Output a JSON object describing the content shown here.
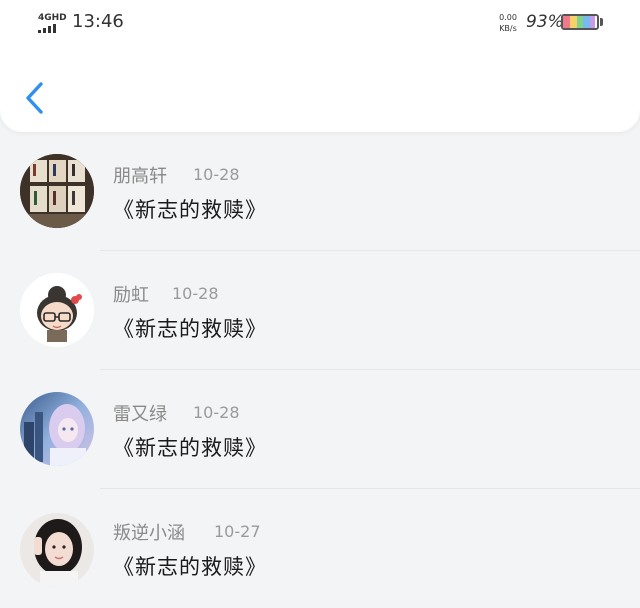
{
  "status_bar": {
    "network": "4GHD",
    "time": "13:46",
    "speed_value": "0.00",
    "speed_unit": "KB/s",
    "battery_percent": "93%"
  },
  "header": {
    "back_icon": "chevron-left-icon",
    "accent_color": "#2f8ff0"
  },
  "comments": [
    {
      "name": "朋高轩",
      "date": "10-28",
      "message": "《新志的救赎》",
      "avatar": "bookshelf-photo"
    },
    {
      "name": "励虹",
      "date": "10-28",
      "message": "《新志的救赎》",
      "avatar": "cartoon-girl-glasses"
    },
    {
      "name": "雷又绿",
      "date": "10-28",
      "message": "《新志的救赎》",
      "avatar": "anime-girl-art"
    },
    {
      "name": "叛逆小涵",
      "date": "10-27",
      "message": "《新志的救赎》",
      "avatar": "girl-photo"
    }
  ]
}
